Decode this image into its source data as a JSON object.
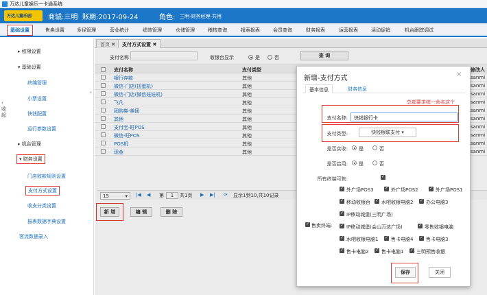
{
  "window_title": "万达儿童娱乐一卡通系统",
  "logo_text": "万达儿童乐园",
  "header": {
    "store": "商城:三明",
    "period": "账期:2017-09-24",
    "role_label": "角色:",
    "role_value": "三明-财务经理-共用"
  },
  "nav": [
    "基础设置",
    "售卖设置",
    "多径管理",
    "营业统计",
    "绩效管理",
    "仓储管理",
    "稽核查询",
    "报表报表",
    "会员查询",
    "财务报表",
    "运营报表",
    "活动促销",
    "机台跟踪调试"
  ],
  "sidebar": {
    "collapse_label": "收起",
    "groups": [
      {
        "label": "权限设置",
        "items": []
      },
      {
        "label": "基础设置",
        "items": [
          "终端管理",
          "小票设置",
          "快钱配置",
          "运行参数设置"
        ]
      },
      {
        "label": "机台管理",
        "items": []
      },
      {
        "label": "财务设置",
        "items": [
          "门店收款规则设置",
          "支付方式设置",
          "收支分类设置",
          "报表数据字典设置"
        ]
      }
    ],
    "tail": "客流数据录入"
  },
  "tabs": {
    "home": "首页",
    "home_close": "✖",
    "current": "支付方式设置",
    "current_close": "✖"
  },
  "search": {
    "name_label": "支付名称",
    "display_label": "收银台显示",
    "opt_yes": "是",
    "opt_no": "否",
    "query_btn": "查 询"
  },
  "grid": {
    "headers": [
      "支付名称",
      "支付类型",
      "修改人"
    ],
    "rows": [
      [
        "银行存款",
        "其他",
        "sanmi"
      ],
      [
        "微信-门店(扭蛋机)",
        "其他",
        "sanmi"
      ],
      [
        "微信-门店(微信娃娃机)",
        "其他",
        "sanmi"
      ],
      [
        "飞凡",
        "其他",
        "sanmi"
      ],
      [
        "团购券-美团",
        "其他",
        "sanmi"
      ],
      [
        "其他",
        "其他",
        "sanmi"
      ],
      [
        "支付宝-旺POS",
        "其他",
        "sanmi"
      ],
      [
        "微信-旺POS",
        "其他",
        "sanmi"
      ],
      [
        "POS机",
        "其他",
        "sanmi"
      ],
      [
        "现金",
        "其他",
        "sanmi"
      ]
    ],
    "page_size": "15",
    "page_label_pre": "第",
    "page_num": "1",
    "page_label_post": "共1页",
    "record_info": "显示1到10,共10记录"
  },
  "actions": {
    "add": "新 增",
    "edit": "编 辑",
    "delete": "删 除"
  },
  "dialog": {
    "title": "新增-支付方式",
    "close": "×",
    "tab_basic": "基本信息",
    "tab_finance": "财务信息",
    "annotation": "总部要求统一命名这个",
    "name_label": "支付名称:",
    "name_value": "快钱银行卡",
    "type_label": "支付类型:",
    "type_value": "快钱银联支付",
    "realcash_label": "是否实收:",
    "enabled_label": "是否启用:",
    "yes": "是",
    "no": "否",
    "all_terminal_label": "所有终端可售:",
    "terminals_label": "售卖终端:",
    "terminals": [
      [
        "外广场POS3",
        "外广场POS2",
        "外广场POS1"
      ],
      [
        "移动收银台",
        "水吧收银电脑2",
        "办公电脑3"
      ],
      [
        "IP移动城堡(三明广场)"
      ],
      [
        "IP移动城堡(会山万达广场)",
        "零售收银电脑"
      ],
      [
        "水吧收银电脑1",
        "售卡电脑4",
        "售卡电脑3"
      ],
      [
        "售卡电脑2",
        "售卡电脑1",
        "三明预售收银"
      ]
    ],
    "save": "保存",
    "cancel": "关闭"
  },
  "colors": {
    "brand_blue": "#1b76c8",
    "annotation_red": "#e53935",
    "logo_yellow": "#f3c500"
  }
}
